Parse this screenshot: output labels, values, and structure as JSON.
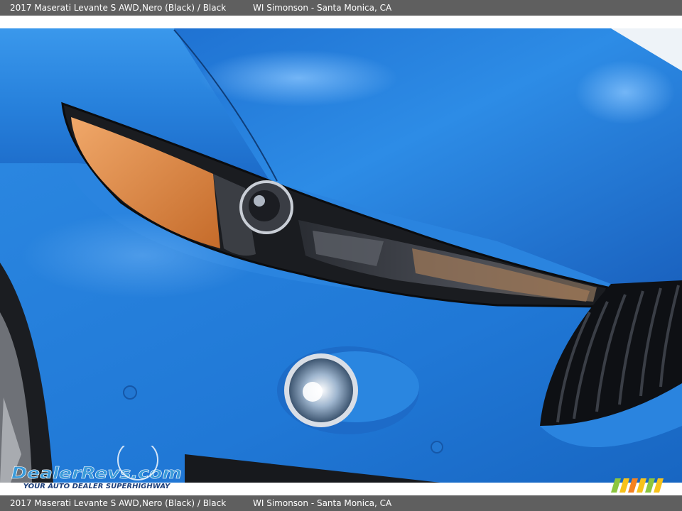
{
  "caption": {
    "vehicle": "2017 Maserati Levante S AWD,",
    "color": "Nero (Black)  /  Black",
    "dealer": "WI Simonson - Santa Monica, CA"
  },
  "watermark": {
    "brand": "DealerRevs.com",
    "tagline": "YOUR AUTO DEALER SUPERHIGHWAY",
    "colors": {
      "dealer": "#f29a1f",
      "revs": "#3a9ad9",
      "com": "#1d3f7a",
      "tagline": "#1d3f7a"
    }
  },
  "image": {
    "subject": "Front headlight and hood of a matte blue Maserati Levante",
    "paint_color": "#2f7fd6"
  }
}
